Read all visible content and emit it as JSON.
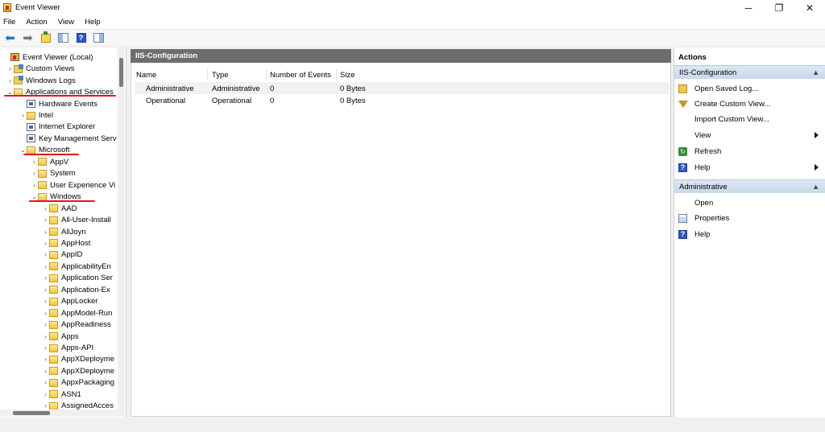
{
  "window": {
    "title": "Event Viewer",
    "controls": {
      "minimize": "─",
      "maximize": "❐",
      "close": "✕"
    }
  },
  "menu": [
    "File",
    "Action",
    "View",
    "Help"
  ],
  "toolbar": {
    "icons": [
      "back-icon",
      "forward-icon",
      "show-hide-tree-icon",
      "scope-icon",
      "help-icon",
      "properties-icon"
    ],
    "help_glyph": "?"
  },
  "tree": [
    {
      "label": "Event Viewer (Local)",
      "expanded": null,
      "icon": "event-viewer-icon"
    },
    {
      "label": "Custom Views",
      "expanded": false,
      "icon": "custom-views-icon"
    },
    {
      "label": "Windows Logs",
      "expanded": false,
      "icon": "windows-logs-icon"
    },
    {
      "label": "Applications and Services",
      "expanded": true,
      "icon": "open-folder-icon"
    },
    {
      "label": "Hardware Events",
      "expanded": null,
      "icon": "log-icon"
    },
    {
      "label": "Intel",
      "expanded": false,
      "icon": "folder-icon"
    },
    {
      "label": "Internet Explorer",
      "expanded": null,
      "icon": "log-icon"
    },
    {
      "label": "Key Management Serv",
      "expanded": null,
      "icon": "log-icon"
    },
    {
      "label": "Microsoft",
      "expanded": true,
      "icon": "open-folder-icon"
    },
    {
      "label": "AppV",
      "expanded": false,
      "icon": "folder-icon"
    },
    {
      "label": "System",
      "expanded": false,
      "icon": "folder-icon"
    },
    {
      "label": "User Experience Vi",
      "expanded": false,
      "icon": "folder-icon"
    },
    {
      "label": "Windows",
      "expanded": true,
      "icon": "open-folder-icon"
    },
    {
      "label": "AAD",
      "expanded": false,
      "icon": "folder-icon"
    },
    {
      "label": "All-User-Install",
      "expanded": false,
      "icon": "folder-icon"
    },
    {
      "label": "AllJoyn",
      "expanded": false,
      "icon": "folder-icon"
    },
    {
      "label": "AppHost",
      "expanded": false,
      "icon": "folder-icon"
    },
    {
      "label": "AppID",
      "expanded": false,
      "icon": "folder-icon"
    },
    {
      "label": "ApplicabilityEn",
      "expanded": false,
      "icon": "folder-icon"
    },
    {
      "label": "Application Ser",
      "expanded": false,
      "icon": "folder-icon"
    },
    {
      "label": "Application-Ex",
      "expanded": false,
      "icon": "folder-icon"
    },
    {
      "label": "AppLocker",
      "expanded": false,
      "icon": "folder-icon"
    },
    {
      "label": "AppModel-Run",
      "expanded": false,
      "icon": "folder-icon"
    },
    {
      "label": "AppReadiness",
      "expanded": false,
      "icon": "folder-icon"
    },
    {
      "label": "Apps",
      "expanded": false,
      "icon": "folder-icon"
    },
    {
      "label": "Apps-API",
      "expanded": false,
      "icon": "folder-icon"
    },
    {
      "label": "AppXDeployme",
      "expanded": false,
      "icon": "folder-icon"
    },
    {
      "label": "AppXDeployme",
      "expanded": false,
      "icon": "folder-icon"
    },
    {
      "label": "AppxPackaging",
      "expanded": false,
      "icon": "folder-icon"
    },
    {
      "label": "ASN1",
      "expanded": false,
      "icon": "folder-icon"
    },
    {
      "label": "AssignedAcces",
      "expanded": false,
      "icon": "folder-icon"
    }
  ],
  "center": {
    "header": "IIS-Configuration",
    "columns": [
      "Name",
      "Type",
      "Number of Events",
      "Size"
    ],
    "rows": [
      {
        "name": "Administrative",
        "type": "Administrative",
        "events": "0",
        "size": "0 Bytes"
      },
      {
        "name": "Operational",
        "type": "Operational",
        "events": "0",
        "size": "0 Bytes"
      }
    ]
  },
  "actions": {
    "title": "Actions",
    "sections": [
      {
        "title": "IIS-Configuration",
        "items": [
          {
            "label": "Open Saved Log...",
            "icon": "open-log-icon",
            "submenu": false
          },
          {
            "label": "Create Custom View...",
            "icon": "filter-icon",
            "submenu": false
          },
          {
            "label": "Import Custom View...",
            "icon": "",
            "submenu": false
          },
          {
            "label": "View",
            "icon": "",
            "submenu": true
          },
          {
            "label": "Refresh",
            "icon": "refresh-icon",
            "submenu": false
          },
          {
            "label": "Help",
            "icon": "help-icon",
            "submenu": true
          }
        ]
      },
      {
        "title": "Administrative",
        "items": [
          {
            "label": "Open",
            "icon": "",
            "submenu": false
          },
          {
            "label": "Properties",
            "icon": "properties-icon",
            "submenu": false
          },
          {
            "label": "Help",
            "icon": "help-icon",
            "submenu": false
          }
        ]
      }
    ]
  },
  "colors": {
    "annotation_red": "#e4141b",
    "header_gray": "#6d6d6d",
    "section_blue": "#d7e4f3"
  }
}
